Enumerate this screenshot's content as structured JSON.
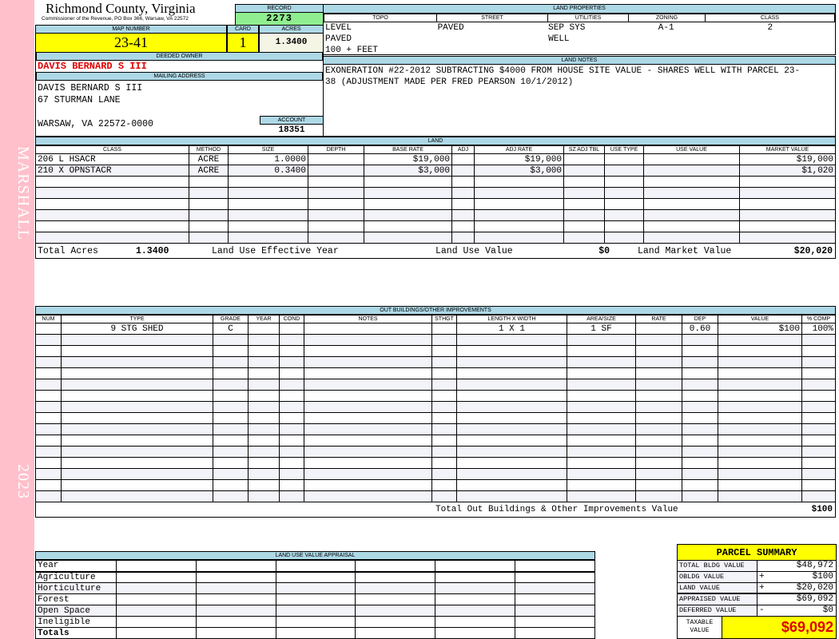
{
  "sidebar": {
    "district": "MARSHALL",
    "year": "2023"
  },
  "header": {
    "county": "Richmond County, Virginia",
    "office": "Commissioner of the Revenue, PO Box 366, Warsaw, VA 22572",
    "record_label": "RECORD",
    "record": "2273",
    "map_label": "MAP NUMBER",
    "map": "23-41",
    "card_label": "CARD",
    "card": "1",
    "acres_label": "ACRES",
    "acres": "1.3400"
  },
  "owner": {
    "deeded_label": "DEEDED OWNER",
    "deeded": "DAVIS BERNARD S III",
    "mailing_label": "MAILING ADDRESS",
    "lines": [
      "DAVIS BERNARD S III",
      "67 STURMAN LANE",
      "",
      "WARSAW, VA 22572-0000"
    ],
    "account_label": "ACCOUNT",
    "account": "18351"
  },
  "land_properties": {
    "title": "LAND PROPERTIES",
    "columns": [
      "TOPO",
      "STREET",
      "UTILITIES",
      "ZONING",
      "CLASS"
    ],
    "rows": [
      [
        "LEVEL",
        "PAVED",
        "SEP SYS",
        "A-1",
        "2"
      ],
      [
        "PAVED",
        "",
        "WELL",
        "",
        ""
      ],
      [
        "100 + FEET",
        "",
        "",
        "",
        ""
      ]
    ]
  },
  "land_notes": {
    "title": "LAND NOTES",
    "text": "EXONERATION #22-2012 SUBTRACTING $4000 FROM HOUSE SITE VALUE - SHARES WELL WITH PARCEL 23-38 (ADJUSTMENT MADE PER FRED PEARSON 10/1/2012)"
  },
  "land": {
    "title": "LAND",
    "columns": [
      "CLASS",
      "METHOD",
      "SIZE",
      "DEPTH",
      "BASE RATE",
      "ADJ",
      "ADJ RATE",
      "SZ ADJ TBL",
      "USE TYPE",
      "USE VALUE",
      "MARKET VALUE"
    ],
    "rows": [
      [
        "206 L HSACR",
        "ACRE",
        "1.0000",
        "",
        "$19,000",
        "",
        "$19,000",
        "",
        "",
        "",
        "$19,000"
      ],
      [
        "210 X OPNSTACR",
        "ACRE",
        "0.3400",
        "",
        "$3,000",
        "",
        "$3,000",
        "",
        "",
        "",
        "$1,020"
      ]
    ],
    "totals": {
      "acres_label": "Total Acres",
      "acres": "1.3400",
      "eff_year_label": "Land Use Effective Year",
      "use_value_label": "Land Use Value",
      "use_value": "$0",
      "market_label": "Land Market Value",
      "market": "$20,020"
    }
  },
  "outbuildings": {
    "title": "OUT BUILDINGS/OTHER IMPROVEMENTS",
    "columns": [
      "NUM",
      "TYPE",
      "GRADE",
      "YEAR",
      "COND",
      "NOTES",
      "STHGT",
      "LENGTH X WIDTH",
      "AREA/SIZE",
      "RATE",
      "DEP",
      "VALUE",
      "% COMP"
    ],
    "rows": [
      [
        "",
        "9 STG SHED",
        "C",
        "",
        "",
        "",
        "",
        "1 X 1",
        "1 SF",
        "",
        "0.60",
        "$100",
        "100%"
      ]
    ],
    "total_label": "Total Out Buildings & Other Improvements Value",
    "total": "$100"
  },
  "land_use": {
    "title": "LAND USE VALUE APPRAISAL",
    "year_label": "Year",
    "rows": [
      "Agriculture",
      "Horticulture",
      "Forest",
      "Open Space",
      "Ineligible"
    ],
    "totals_label": "Totals"
  },
  "summary": {
    "title": "PARCEL SUMMARY",
    "rows": [
      {
        "label": "TOTAL BLDG VALUE",
        "sign": "",
        "value": "$48,972"
      },
      {
        "label": "OBLDG VALUE",
        "sign": "+",
        "value": "$100"
      },
      {
        "label": "LAND VALUE",
        "sign": "+",
        "value": "$20,020"
      },
      {
        "label": "APPRAISED VALUE",
        "sign": "",
        "value": "$69,092"
      },
      {
        "label": "DEFERRED VALUE",
        "sign": "-",
        "value": "$0"
      }
    ],
    "taxable_label": "TAXABLE VALUE",
    "taxable": "$69,092"
  },
  "colors": {
    "header_blue": "#add8e6",
    "highlight_yellow": "#ffff00",
    "record_green": "#90ee90",
    "owner_red": "#e00000",
    "sidebar_pink": "#ffc0cb"
  }
}
